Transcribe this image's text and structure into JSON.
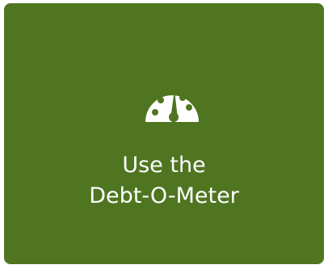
{
  "tile": {
    "background": "#4f7521",
    "icon": "speedometer-icon",
    "label_line1": "Use the",
    "label_line2": "Debt-O-Meter"
  }
}
